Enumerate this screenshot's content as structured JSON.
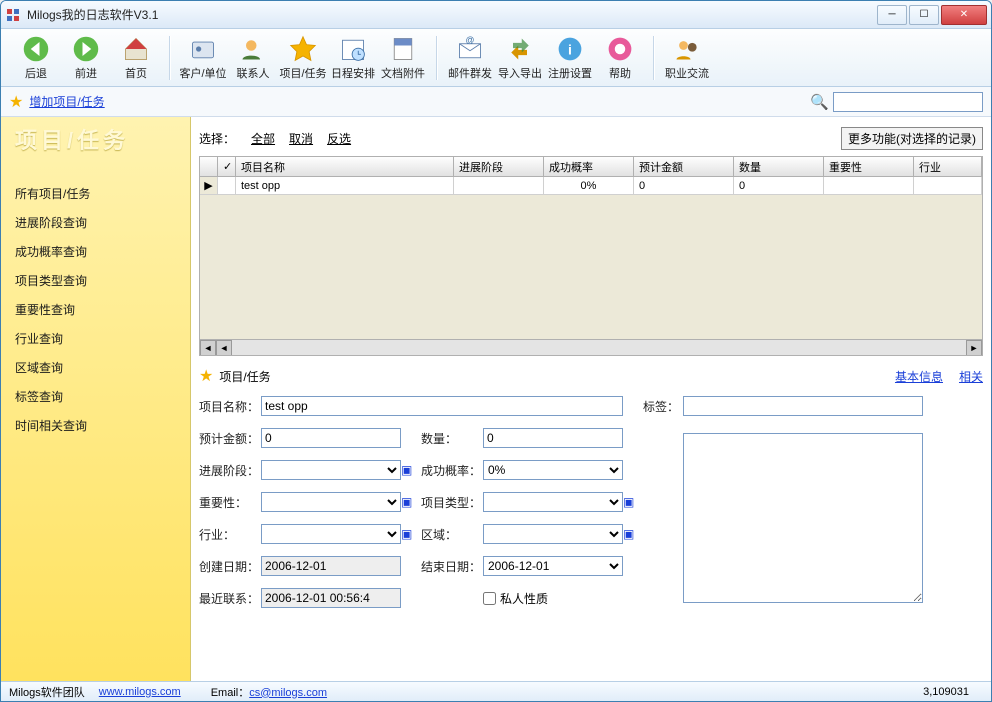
{
  "app_title": "Milogs我的日志软件V3.1",
  "toolbar": {
    "back": "后退",
    "forward": "前进",
    "home": "首页",
    "clients": "客户/单位",
    "contacts": "联系人",
    "projects": "项目/任务",
    "schedule": "日程安排",
    "attachments": "文档附件",
    "mail": "邮件群发",
    "importexport": "导入导出",
    "register": "注册设置",
    "help": "帮助",
    "career": "职业交流"
  },
  "action_bar": {
    "add_project": "增加项目/任务"
  },
  "sidebar": {
    "header": "项目/任务",
    "items": [
      "所有项目/任务",
      "进展阶段查询",
      "成功概率查询",
      "项目类型查询",
      "重要性查询",
      "行业查询",
      "区域查询",
      "标签查询",
      "时间相关查询"
    ]
  },
  "select_row": {
    "label": "选择：",
    "all": "全部",
    "cancel": "取消",
    "invert": "反选",
    "more": "更多功能(对选择的记录)"
  },
  "grid": {
    "cols": [
      "",
      "✓",
      "项目名称",
      "进展阶段",
      "成功概率",
      "预计金额",
      "数量",
      "重要性",
      "行业"
    ],
    "rows": [
      {
        "name": "test opp",
        "stage": "",
        "prob": "0%",
        "amount": "0",
        "qty": "0",
        "importance": "",
        "industry": ""
      }
    ]
  },
  "detail": {
    "header": "项目/任务",
    "tab_basic": "基本信息",
    "tab_related": "相关",
    "labels": {
      "name": "项目名称：",
      "tags": "标签：",
      "amount": "预计金额：",
      "qty": "数量：",
      "stage": "进展阶段：",
      "prob": "成功概率：",
      "importance": "重要性：",
      "ptype": "项目类型：",
      "industry": "行业：",
      "region": "区域：",
      "created": "创建日期：",
      "end": "结束日期：",
      "lastcontact": "最近联系：",
      "private": "私人性质"
    },
    "values": {
      "name": "test opp",
      "tags": "",
      "amount": "0",
      "qty": "0",
      "stage": "",
      "prob": "0%",
      "importance": "",
      "ptype": "",
      "industry": "",
      "region": "",
      "created": "2006-12-01",
      "end": "2006-12-01",
      "lastcontact": "2006-12-01 00:56:4"
    }
  },
  "status": {
    "team": "Milogs软件团队",
    "url": "www.milogs.com",
    "email_lbl": "Email：",
    "email": "cs@milogs.com",
    "build": "3,109031"
  }
}
